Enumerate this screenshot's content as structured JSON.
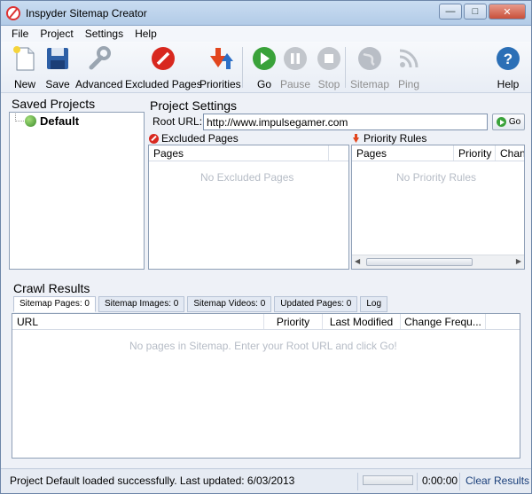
{
  "window": {
    "title": "Inspyder Sitemap Creator"
  },
  "menu": [
    "File",
    "Project",
    "Settings",
    "Help"
  ],
  "toolbar": {
    "new": "New",
    "save": "Save",
    "advanced": "Advanced",
    "excluded_pages": "Excluded Pages",
    "priorities": "Priorities",
    "go": "Go",
    "pause": "Pause",
    "stop": "Stop",
    "sitemap": "Sitemap",
    "ping": "Ping",
    "help": "Help"
  },
  "saved_projects": {
    "title": "Saved Projects",
    "items": [
      "Default"
    ]
  },
  "project_settings": {
    "title": "Project Settings",
    "root_url_label": "Root URL:",
    "root_url_value": "http://www.impulsegamer.com",
    "go_label": "Go"
  },
  "excluded": {
    "title": "Excluded Pages",
    "header": "Pages",
    "empty": "No Excluded Pages"
  },
  "priority_rules": {
    "title": "Priority Rules",
    "headers": [
      "Pages",
      "Priority",
      "Chan"
    ],
    "empty": "No Priority Rules"
  },
  "crawl": {
    "title": "Crawl Results",
    "tabs": [
      "Sitemap Pages: 0",
      "Sitemap Images: 0",
      "Sitemap Videos: 0",
      "Updated Pages: 0",
      "Log"
    ],
    "headers": [
      "URL",
      "Priority",
      "Last Modified",
      "Change Frequ..."
    ],
    "empty": "No pages in Sitemap. Enter your Root URL and click Go!"
  },
  "status": {
    "message": "Project Default loaded successfully. Last updated: 6/03/2013",
    "time": "0:00:00",
    "clear": "Clear Results"
  },
  "colors": {
    "accent": "#2b6fb6",
    "go_green": "#3aa23a",
    "excluded_red": "#d8281f"
  }
}
